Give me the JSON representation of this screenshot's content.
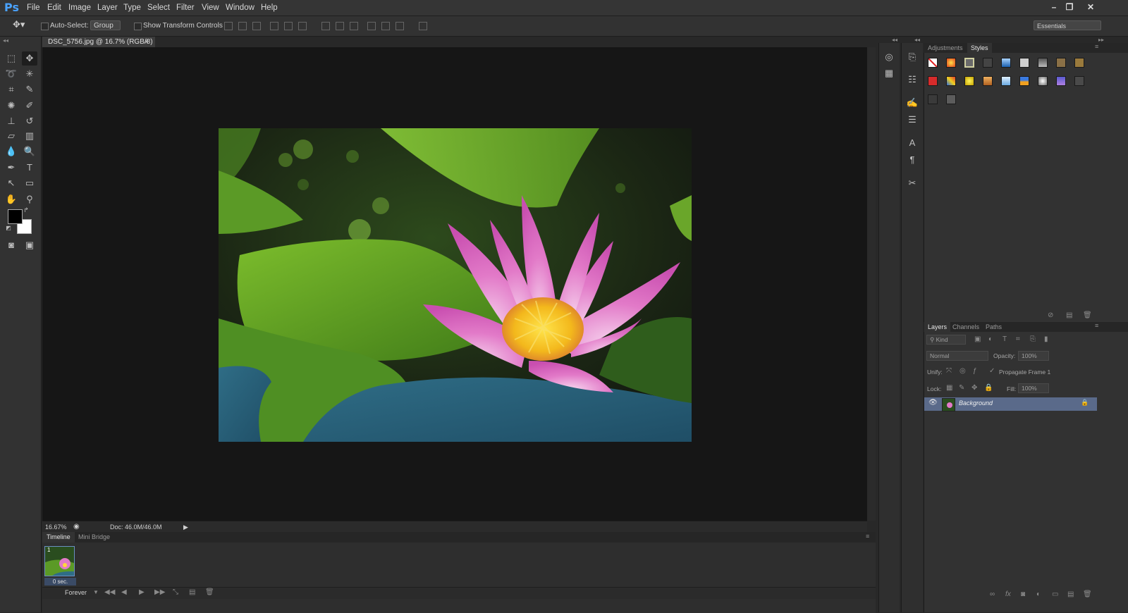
{
  "app": {
    "logo": "Ps"
  },
  "menu": [
    "File",
    "Edit",
    "Image",
    "Layer",
    "Type",
    "Select",
    "Filter",
    "View",
    "Window",
    "Help"
  ],
  "window_controls": {
    "minimize": "–",
    "restore": "❐",
    "close": "✕"
  },
  "options_bar": {
    "auto_select_label": "Auto-Select:",
    "auto_select_value": "Group",
    "show_transform_label": "Show Transform Controls",
    "workspace": "Essentials"
  },
  "document": {
    "tab_title": "DSC_5756.jpg @ 16.7% (RGB/8)",
    "tab_close": "×",
    "zoom": "16.67%",
    "doc_size": "Doc: 46.0M/46.0M"
  },
  "timeline": {
    "tabs": [
      "Timeline",
      "Mini Bridge"
    ],
    "frame_number": "1",
    "frame_delay": "0 sec.",
    "loop": "Forever"
  },
  "styles_panel": {
    "tabs": [
      "Adjustments",
      "Styles"
    ],
    "active_tab": "Styles"
  },
  "layers_panel": {
    "tabs": [
      "Layers",
      "Channels",
      "Paths"
    ],
    "kind_label": "Kind",
    "blend_mode": "Normal",
    "opacity_label": "Opacity:",
    "opacity_value": "100%",
    "unify_label": "Unify:",
    "propagate_label": "Propagate Frame 1",
    "lock_label": "Lock:",
    "fill_label": "Fill:",
    "fill_value": "100%",
    "layers": [
      {
        "name": "Background",
        "visible": true,
        "locked": true
      }
    ]
  },
  "colors": {
    "accent": "#4aa3ff",
    "selected_layer": "#5a6a8a",
    "foreground": "#000000",
    "background": "#ffffff"
  }
}
